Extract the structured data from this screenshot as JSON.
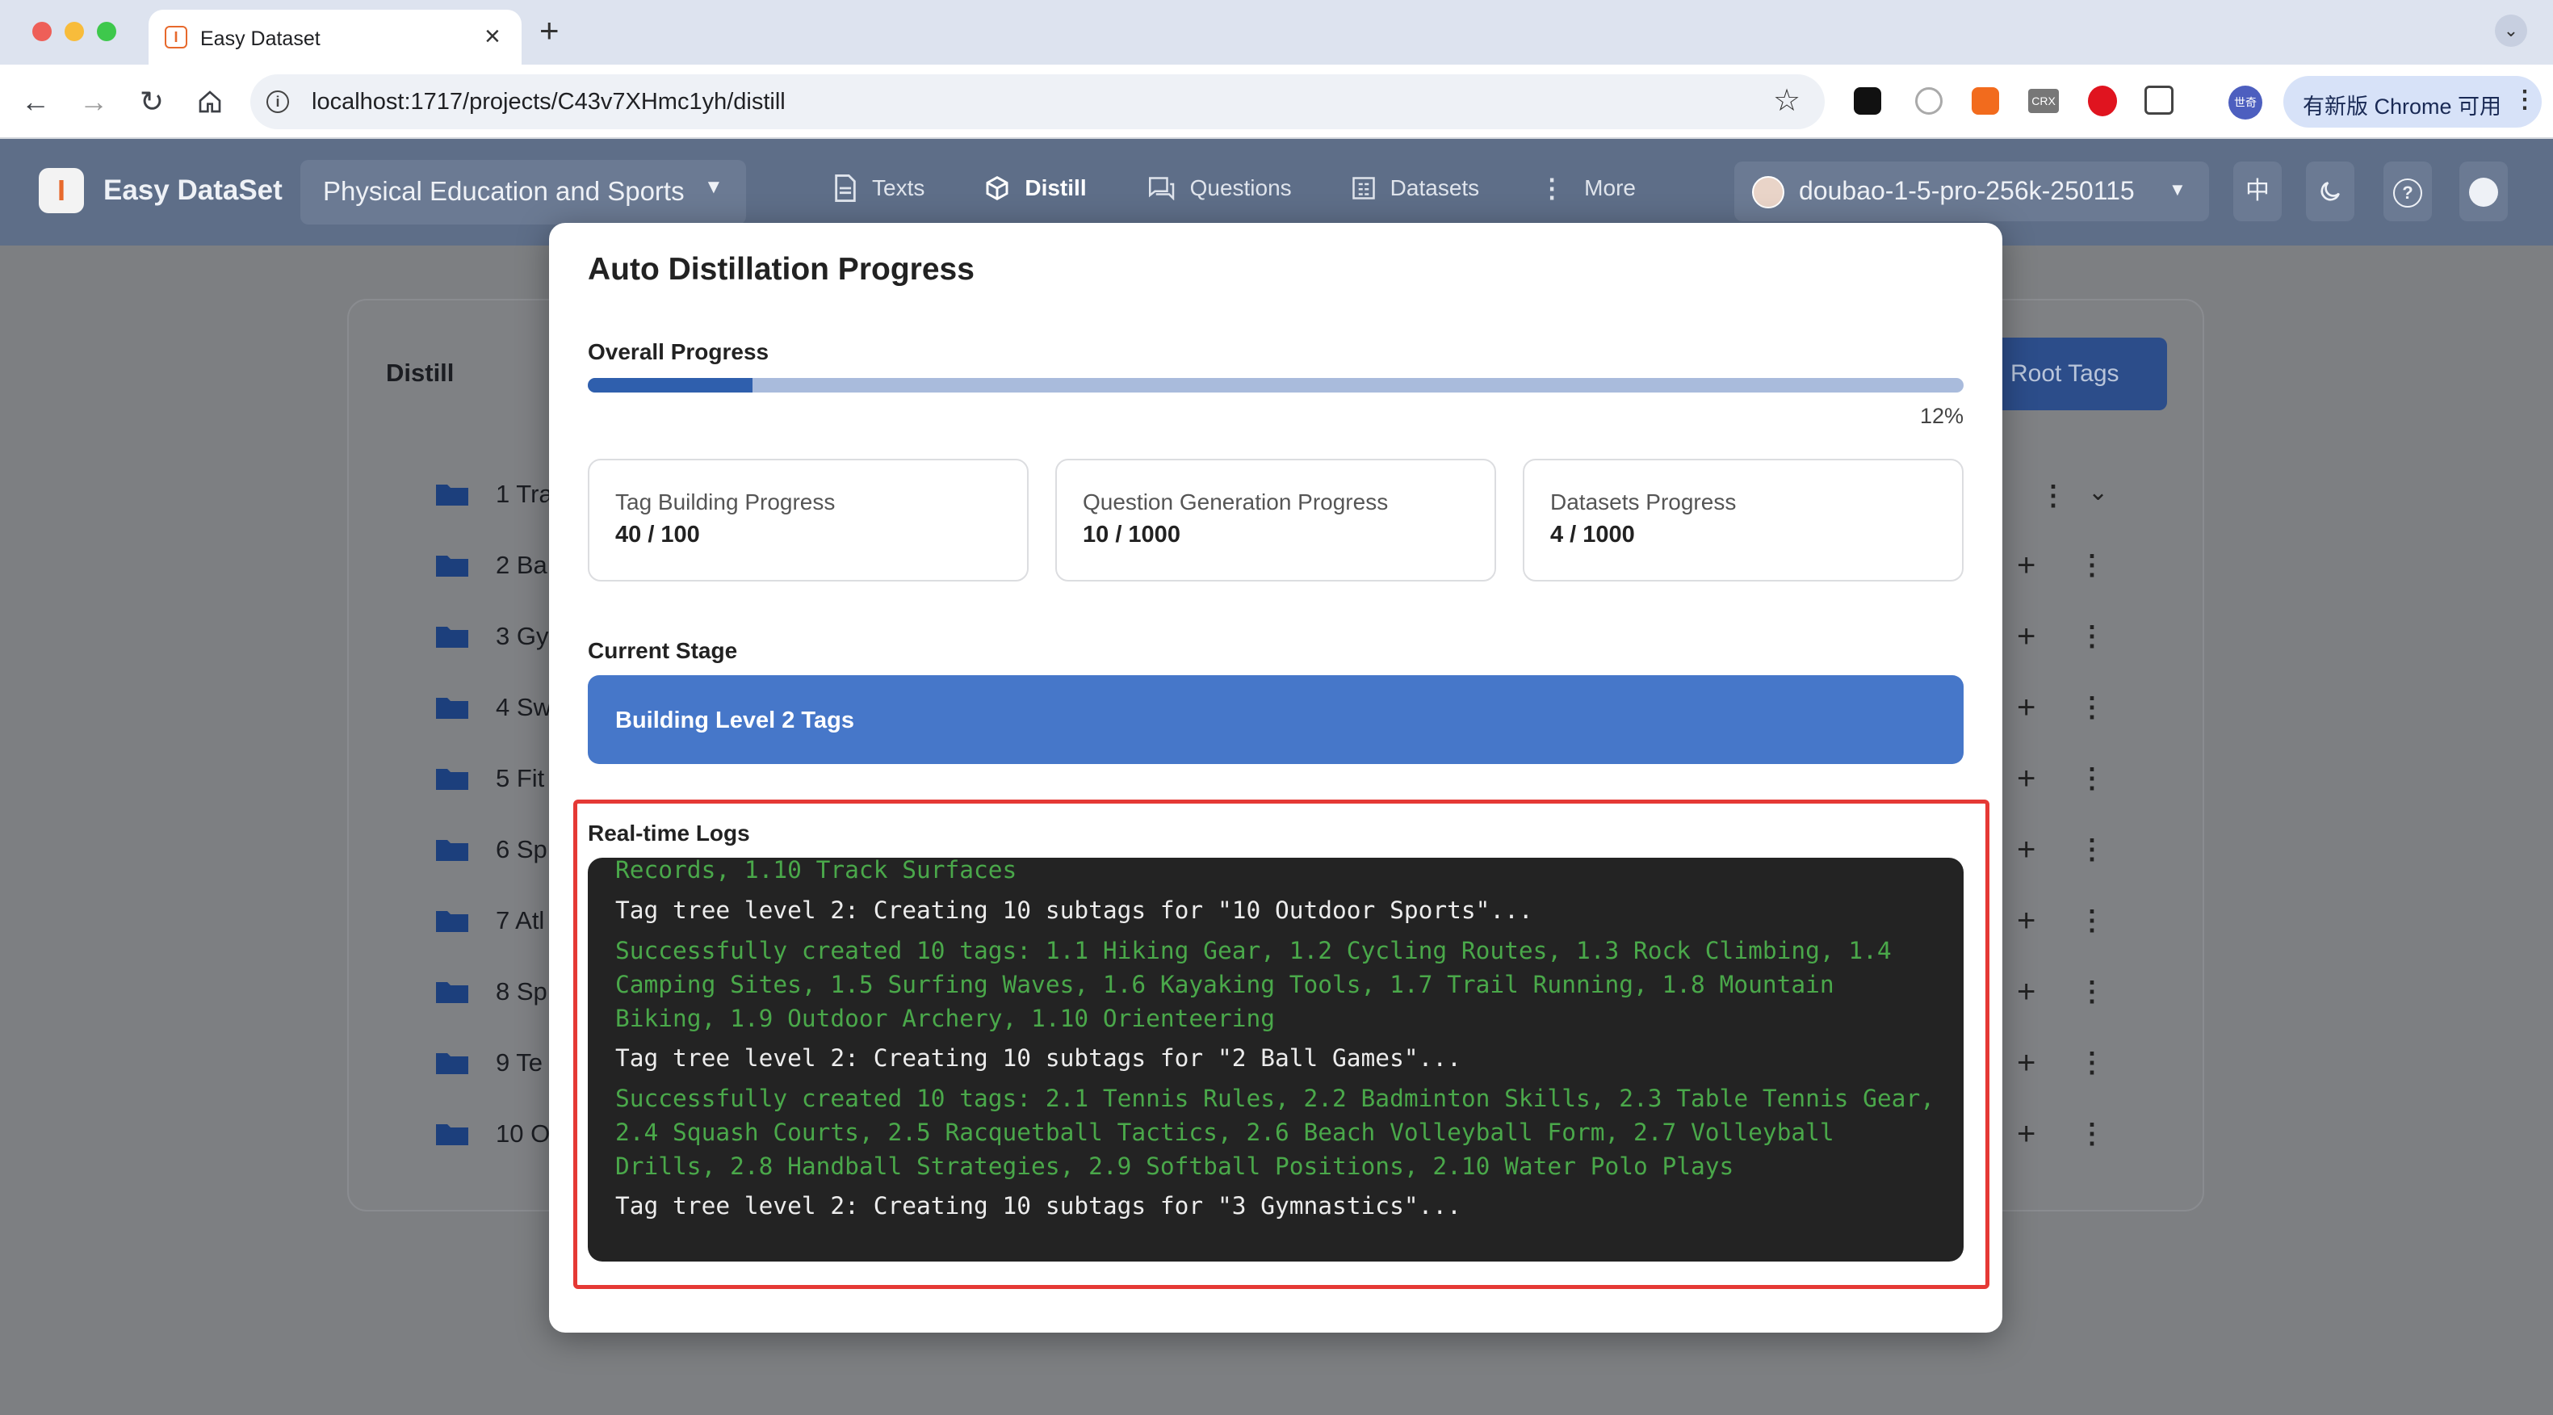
{
  "browser": {
    "tab_title": "Easy Dataset",
    "url": "localhost:1717/projects/C43v7XHmc1yh/distill",
    "update_label": "有新版 Chrome 可用",
    "extension_labels": {
      "crx": "CRX",
      "account": "世奇"
    },
    "colors": {
      "close": "#ee5f58",
      "minimize": "#f8bc3b",
      "maximize": "#3ec84c"
    }
  },
  "header": {
    "app_name": "Easy DataSet",
    "project": "Physical Education and Sports",
    "nav": [
      {
        "label": "Texts",
        "icon": "document-icon"
      },
      {
        "label": "Distill",
        "icon": "cube-icon",
        "active": true
      },
      {
        "label": "Questions",
        "icon": "chat-icon"
      },
      {
        "label": "Datasets",
        "icon": "grid-icon"
      },
      {
        "label": "More",
        "icon": "more-vertical-icon"
      }
    ],
    "model": "doubao-1-5-pro-256k-250115",
    "lang_button": "中"
  },
  "background_page": {
    "title": "Distill",
    "root_tags_button": "Root Tags",
    "rows": [
      "1 Tra",
      "2 Ba",
      "3 Gy",
      "4 Sw",
      "5 Fit",
      "6 Sp",
      "7 Atl",
      "8 Sp",
      "9 Te",
      "10 O"
    ]
  },
  "dialog": {
    "title": "Auto Distillation Progress",
    "overall_label": "Overall Progress",
    "overall_percent_text": "12%",
    "overall_progress": 0.12,
    "stats": [
      {
        "label": "Tag Building Progress",
        "value": "40 / 100"
      },
      {
        "label": "Question Generation Progress",
        "value": "10 / 1000"
      },
      {
        "label": "Datasets Progress",
        "value": "4 / 1000"
      }
    ],
    "stage_label": "Current Stage",
    "stage_value": "Building Level 2 Tags",
    "logs_label": "Real-time Logs",
    "logs": [
      {
        "text": "Records, 1.10 Track Surfaces",
        "type": "success"
      },
      {
        "text": "Tag tree level 2: Creating 10 subtags for \"10 Outdoor Sports\"...",
        "type": "info"
      },
      {
        "text": "Successfully created 10 tags: 1.1 Hiking Gear, 1.2 Cycling Routes, 1.3 Rock Climbing, 1.4 Camping Sites, 1.5 Surfing Waves, 1.6 Kayaking Tools, 1.7 Trail Running, 1.8 Mountain Biking, 1.9 Outdoor Archery, 1.10 Orienteering",
        "type": "success"
      },
      {
        "text": "Tag tree level 2: Creating 10 subtags for \"2 Ball Games\"...",
        "type": "info"
      },
      {
        "text": "Successfully created 10 tags: 2.1 Tennis Rules, 2.2 Badminton Skills, 2.3 Table Tennis Gear, 2.4 Squash Courts, 2.5 Racquetball Tactics, 2.6 Beach Volleyball Form, 2.7 Volleyball Drills, 2.8 Handball Strategies, 2.9 Softball Positions, 2.10 Water Polo Plays",
        "type": "success"
      },
      {
        "text": "Tag tree level 2: Creating 10 subtags for \"3 Gymnastics\"...",
        "type": "info"
      }
    ],
    "colors": {
      "progress_fill": "#2f5fad",
      "progress_track": "#a9bbdc",
      "stage_bg": "#4677c9",
      "highlight": "#e53935"
    }
  }
}
